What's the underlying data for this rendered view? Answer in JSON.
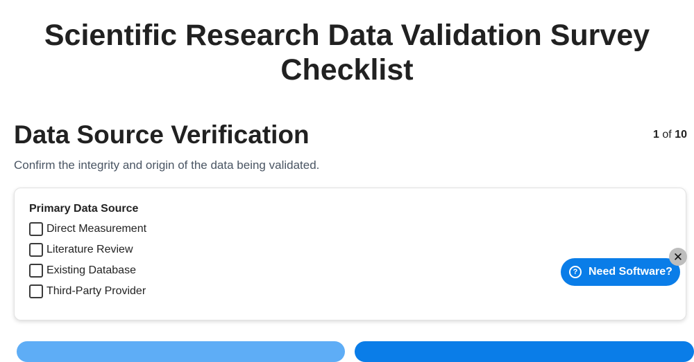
{
  "page": {
    "title": "Scientific Research Data Validation Survey Checklist"
  },
  "section": {
    "title": "Data Source Verification",
    "description": "Confirm the integrity and origin of the data being validated.",
    "progress": {
      "current": "1",
      "of_label": "of",
      "total": "10"
    }
  },
  "question": {
    "label": "Primary Data Source",
    "options": [
      {
        "label": "Direct Measurement",
        "checked": false
      },
      {
        "label": "Literature Review",
        "checked": false
      },
      {
        "label": "Existing Database",
        "checked": false
      },
      {
        "label": "Third-Party Provider",
        "checked": false
      }
    ]
  },
  "help_widget": {
    "label": "Need Software?",
    "icon": "question-circle-icon",
    "close_icon": "close-icon",
    "close_glyph": "✕"
  },
  "colors": {
    "primary": "#0a7de8",
    "primary_light": "#5eadf6",
    "close_bg": "#bdbdbd"
  }
}
